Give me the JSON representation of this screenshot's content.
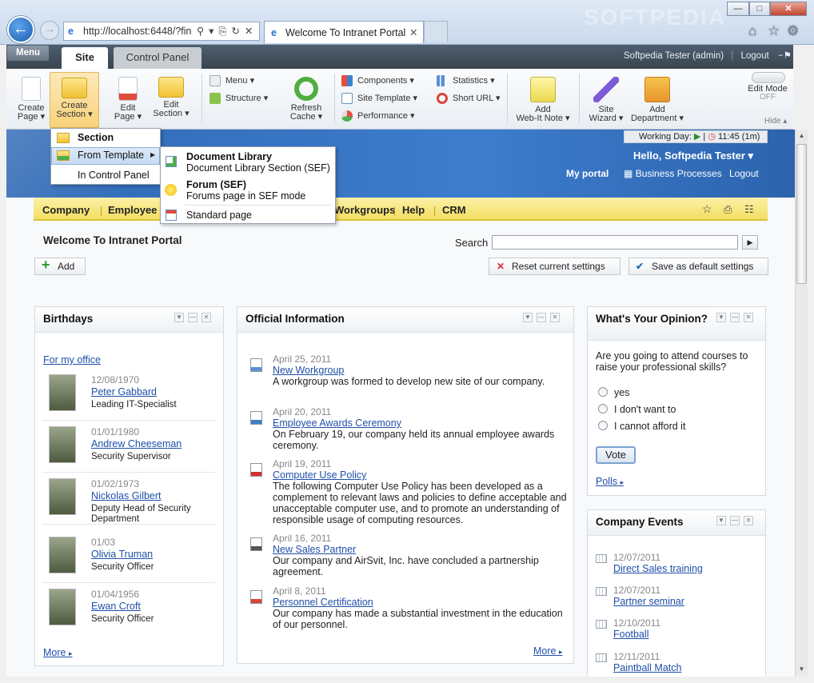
{
  "browser": {
    "address": "http://localhost:6448/?fin",
    "tab_title": "Welcome To Intranet Portal",
    "watermark": "SOFTPEDIA"
  },
  "panel": {
    "menu": "Menu",
    "tabs": [
      "Site",
      "Control Panel"
    ],
    "user": "Softpedia Tester (admin)",
    "logout": "Logout"
  },
  "toolbar": {
    "create_page": [
      "Create",
      "Page"
    ],
    "create_section": [
      "Create",
      "Section"
    ],
    "edit_page": [
      "Edit",
      "Page"
    ],
    "edit_section": [
      "Edit",
      "Section"
    ],
    "menu": "Menu",
    "structure": "Structure",
    "refresh_cache": [
      "Refresh",
      "Cache"
    ],
    "components": "Components",
    "site_template": "Site Template",
    "performance": "Performance",
    "statistics": "Statistics",
    "short_url": "Short URL",
    "add_note": [
      "Add",
      "Web-It Note"
    ],
    "site_wizard": [
      "Site",
      "Wizard"
    ],
    "add_department": [
      "Add",
      "Department"
    ],
    "edit_mode": "Edit Mode",
    "edit_mode_state": "OFF",
    "hide": "Hide"
  },
  "section_menu": {
    "items": [
      "Section",
      "From Template",
      "In Control Panel"
    ]
  },
  "template_menu": {
    "items": [
      {
        "title": "Document Library",
        "desc": "Document Library Section (SEF)"
      },
      {
        "title": "Forum (SEF)",
        "desc": "Forums page in SEF mode"
      },
      {
        "title": "Standard page",
        "desc": ""
      }
    ]
  },
  "header": {
    "working_day": "Working Day:",
    "time": "11:45",
    "duration": "(1m)",
    "greeting": "Hello, Softpedia Tester",
    "my_portal": "My portal",
    "business_processes": "Business Processes",
    "logout": "Logout"
  },
  "nav": [
    "Company",
    "Employee",
    "Workgroups",
    "Help",
    "CRM"
  ],
  "page": {
    "title": "Welcome To Intranet Portal",
    "search_label": "Search",
    "add": "Add",
    "reset": "Reset current settings",
    "save_default": "Save as default settings"
  },
  "birthdays": {
    "title": "Birthdays",
    "filter": "For my office",
    "more": "More",
    "people": [
      {
        "date": "12/08/1970",
        "name": "Peter Gabbard",
        "role": "Leading IT-Specialist"
      },
      {
        "date": "01/01/1980",
        "name": "Andrew Cheeseman",
        "role": "Security Supervisor"
      },
      {
        "date": "01/02/1973",
        "name": "Nickolas Gilbert",
        "role": "Deputy Head of Security Department"
      },
      {
        "date": "01/03",
        "name": "Olivia Truman",
        "role": "Security Officer"
      },
      {
        "date": "01/04/1956",
        "name": "Ewan Croft",
        "role": "Security Officer"
      }
    ]
  },
  "official": {
    "title": "Official Information",
    "more": "More",
    "items": [
      {
        "date": "April 25, 2011",
        "title": "New Workgroup",
        "text": "A workgroup was formed to develop new site of our company."
      },
      {
        "date": "April 20, 2011",
        "title": "Employee Awards Ceremony",
        "text": "On February 19, our company held its annual employee awards ceremony."
      },
      {
        "date": "April 19, 2011",
        "title": "Computer Use Policy",
        "text": "The following Computer Use Policy has been developed as a complement to relevant laws and policies to define acceptable and unacceptable computer use, and to promote an understanding of responsible usage of computing resources."
      },
      {
        "date": "April 16, 2011",
        "title": "New Sales Partner",
        "text": "Our company and AirSvit, Inc. have concluded a partnership agreement."
      },
      {
        "date": "April 8, 2011",
        "title": "Personnel Certification",
        "text": "Our company has made a substantial investment in the education of our personnel."
      }
    ]
  },
  "poll": {
    "title": "What's Your Opinion?",
    "question": "Are you going to attend courses to raise your professional skills?",
    "options": [
      "yes",
      "I don't want to",
      "I cannot afford it"
    ],
    "vote": "Vote",
    "polls": "Polls"
  },
  "events": {
    "title": "Company Events",
    "items": [
      {
        "date": "12/07/2011",
        "title": "Direct Sales training"
      },
      {
        "date": "12/07/2011",
        "title": "Partner seminar"
      },
      {
        "date": "12/10/2011",
        "title": "Football"
      },
      {
        "date": "12/11/2011",
        "title": "Paintball Match"
      }
    ]
  }
}
